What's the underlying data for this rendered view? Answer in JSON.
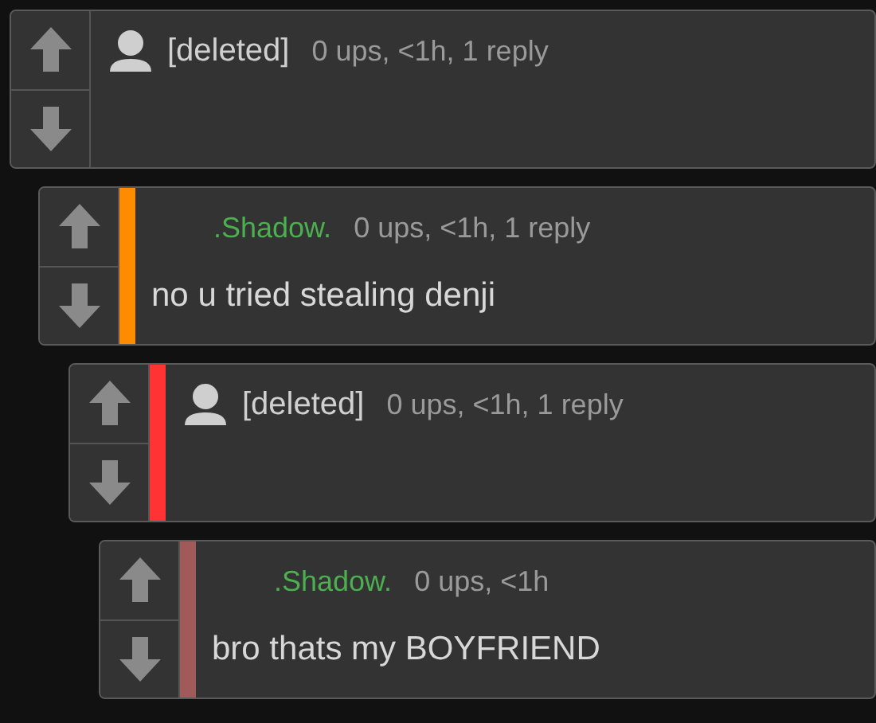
{
  "comments": [
    {
      "kind": "deleted",
      "author": "[deleted]",
      "meta": "0 ups, <1h, 1 reply",
      "children": [
        {
          "kind": "user",
          "color": "#ff8c00",
          "author": ".Shadow.",
          "meta": "0 ups, <1h, 1 reply",
          "text": "no u tried stealing denji",
          "children": [
            {
              "kind": "deleted",
              "color": "#ff3333",
              "author": "[deleted]",
              "meta": "0 ups, <1h, 1 reply",
              "children": [
                {
                  "kind": "user",
                  "color": "#a05a5a",
                  "author": ".Shadow.",
                  "meta": "0 ups, <1h",
                  "text": "bro thats my BOYFRIEND"
                }
              ]
            }
          ]
        }
      ]
    }
  ]
}
